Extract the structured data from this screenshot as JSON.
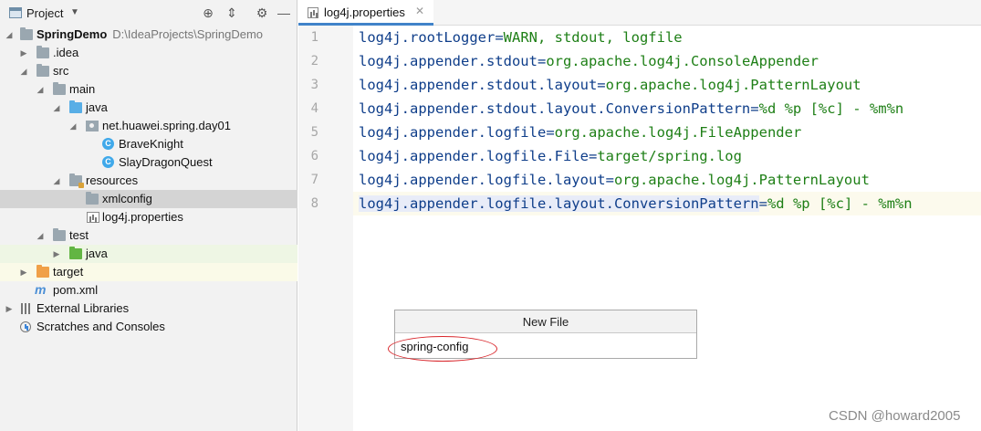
{
  "project_panel": {
    "title": "Project",
    "tree": [
      {
        "label": "SpringDemo",
        "hint": "D:\\IdeaProjects\\SpringDemo"
      },
      {
        "label": ".idea"
      },
      {
        "label": "src"
      },
      {
        "label": "main"
      },
      {
        "label": "java"
      },
      {
        "label": "net.huawei.spring.day01"
      },
      {
        "label": "BraveKnight"
      },
      {
        "label": "SlayDragonQuest"
      },
      {
        "label": "resources"
      },
      {
        "label": "xmlconfig"
      },
      {
        "label": "log4j.properties"
      },
      {
        "label": "test"
      },
      {
        "label": "java"
      },
      {
        "label": "target"
      },
      {
        "label": "pom.xml"
      },
      {
        "label": "External Libraries"
      },
      {
        "label": "Scratches and Consoles"
      }
    ]
  },
  "editor": {
    "tab": {
      "label": "log4j.properties"
    },
    "lines": [
      {
        "num": "1",
        "key": "log4j.rootLogger",
        "value": "WARN, stdout, logfile"
      },
      {
        "num": "2",
        "key": "log4j.appender.stdout",
        "value": "org.apache.log4j.ConsoleAppender"
      },
      {
        "num": "3",
        "key": "log4j.appender.stdout.layout",
        "value": "org.apache.log4j.PatternLayout"
      },
      {
        "num": "4",
        "key": "log4j.appender.stdout.layout.ConversionPattern",
        "value": "%d %p [%c] - %m%n"
      },
      {
        "num": "5",
        "key": "log4j.appender.logfile",
        "value": "org.apache.log4j.FileAppender"
      },
      {
        "num": "6",
        "key": "log4j.appender.logfile.File",
        "value": "target/spring.log"
      },
      {
        "num": "7",
        "key": "log4j.appender.logfile.layout",
        "value": "org.apache.log4j.PatternLayout"
      },
      {
        "num": "8",
        "key": "log4j.appender.logfile.layout.ConversionPattern",
        "value": "%d %p [%c] - %m%n"
      }
    ]
  },
  "new_file_dialog": {
    "title": "New File",
    "input_value": "spring-config"
  },
  "watermark": "CSDN @howard2005",
  "colors": {
    "key": "#0f3e8a",
    "value": "#1e7f16",
    "tab_underline": "#4083c9",
    "annotation": "#d9262b"
  }
}
